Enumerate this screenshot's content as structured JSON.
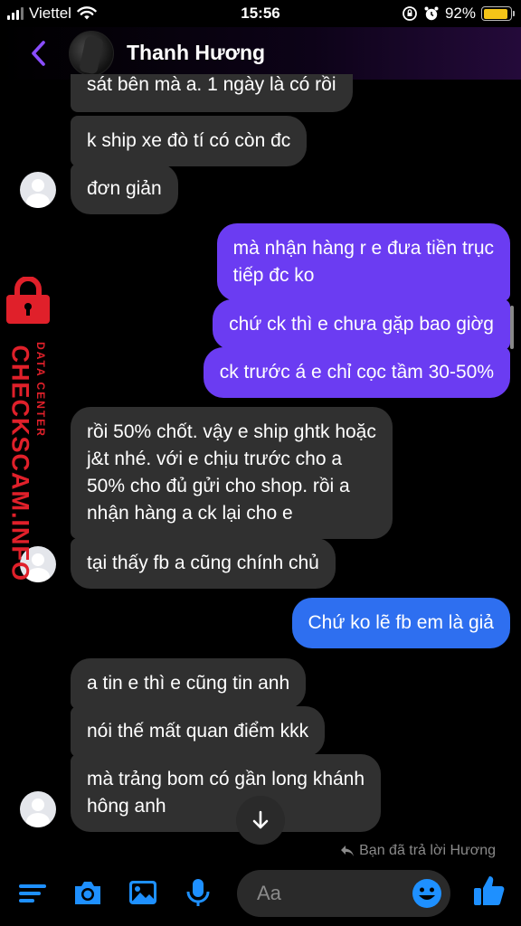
{
  "status_bar": {
    "carrier": "Viettel",
    "time": "15:56",
    "battery": "92%"
  },
  "header": {
    "contact_name": "Thanh Hương"
  },
  "messages": [
    {
      "side": "in",
      "text": "sát bên mà a. 1 ngày là có rồi"
    },
    {
      "side": "in",
      "text": "k ship xe đò tí có còn đc"
    },
    {
      "side": "in",
      "text": "đơn giản"
    },
    {
      "side": "out",
      "line1": "mà nhận hàng r e đưa tiền trục",
      "line2": "tiếp đc ko"
    },
    {
      "side": "out",
      "text": "chứ ck thì e chưa gặp bao giờg"
    },
    {
      "side": "out",
      "text": "ck trước á e chỉ cọc tầm 30-50%"
    },
    {
      "side": "in",
      "line1": "rồi 50% chốt. vậy e ship ghtk hoặc",
      "line2": "j&t nhé. với e chịu trước cho a",
      "line3": "50% cho đủ gửi cho shop. rồi a",
      "line4": "nhận hàng a ck lại cho e"
    },
    {
      "side": "in",
      "text": "tại thấy fb a cũng chính chủ"
    },
    {
      "side": "out",
      "text": "Chứ ko lẽ fb em là giả"
    },
    {
      "side": "in",
      "text": "a tin e thì e cũng tin anh"
    },
    {
      "side": "in",
      "text": "nói thế mất quan điểm kkk"
    },
    {
      "side": "in",
      "line1": "mà trảng bom có gần long khánh",
      "line2": "hông anh"
    }
  ],
  "watermark": {
    "brand": "CHECKSCAM.INFO",
    "sub": "DATA CENTER"
  },
  "reply_note": "Bạn đã trả lời Hương",
  "composer": {
    "placeholder": "Aa"
  },
  "colors": {
    "accent_purple": "#6b3cf2",
    "accent_blue": "#2e6ff0",
    "incoming_bubble": "#303030",
    "messenger_icon": "#1e90ff",
    "watermark_red": "#e0202a"
  },
  "icons": [
    "back-chevron-icon",
    "wifi-icon",
    "signal-icon",
    "orientation-lock-icon",
    "alarm-icon",
    "battery-icon",
    "menu-icon",
    "camera-icon",
    "photo-icon",
    "microphone-icon",
    "emoji-icon",
    "thumbs-up-icon",
    "scroll-down-arrow-icon",
    "reply-icon",
    "lock-icon"
  ]
}
